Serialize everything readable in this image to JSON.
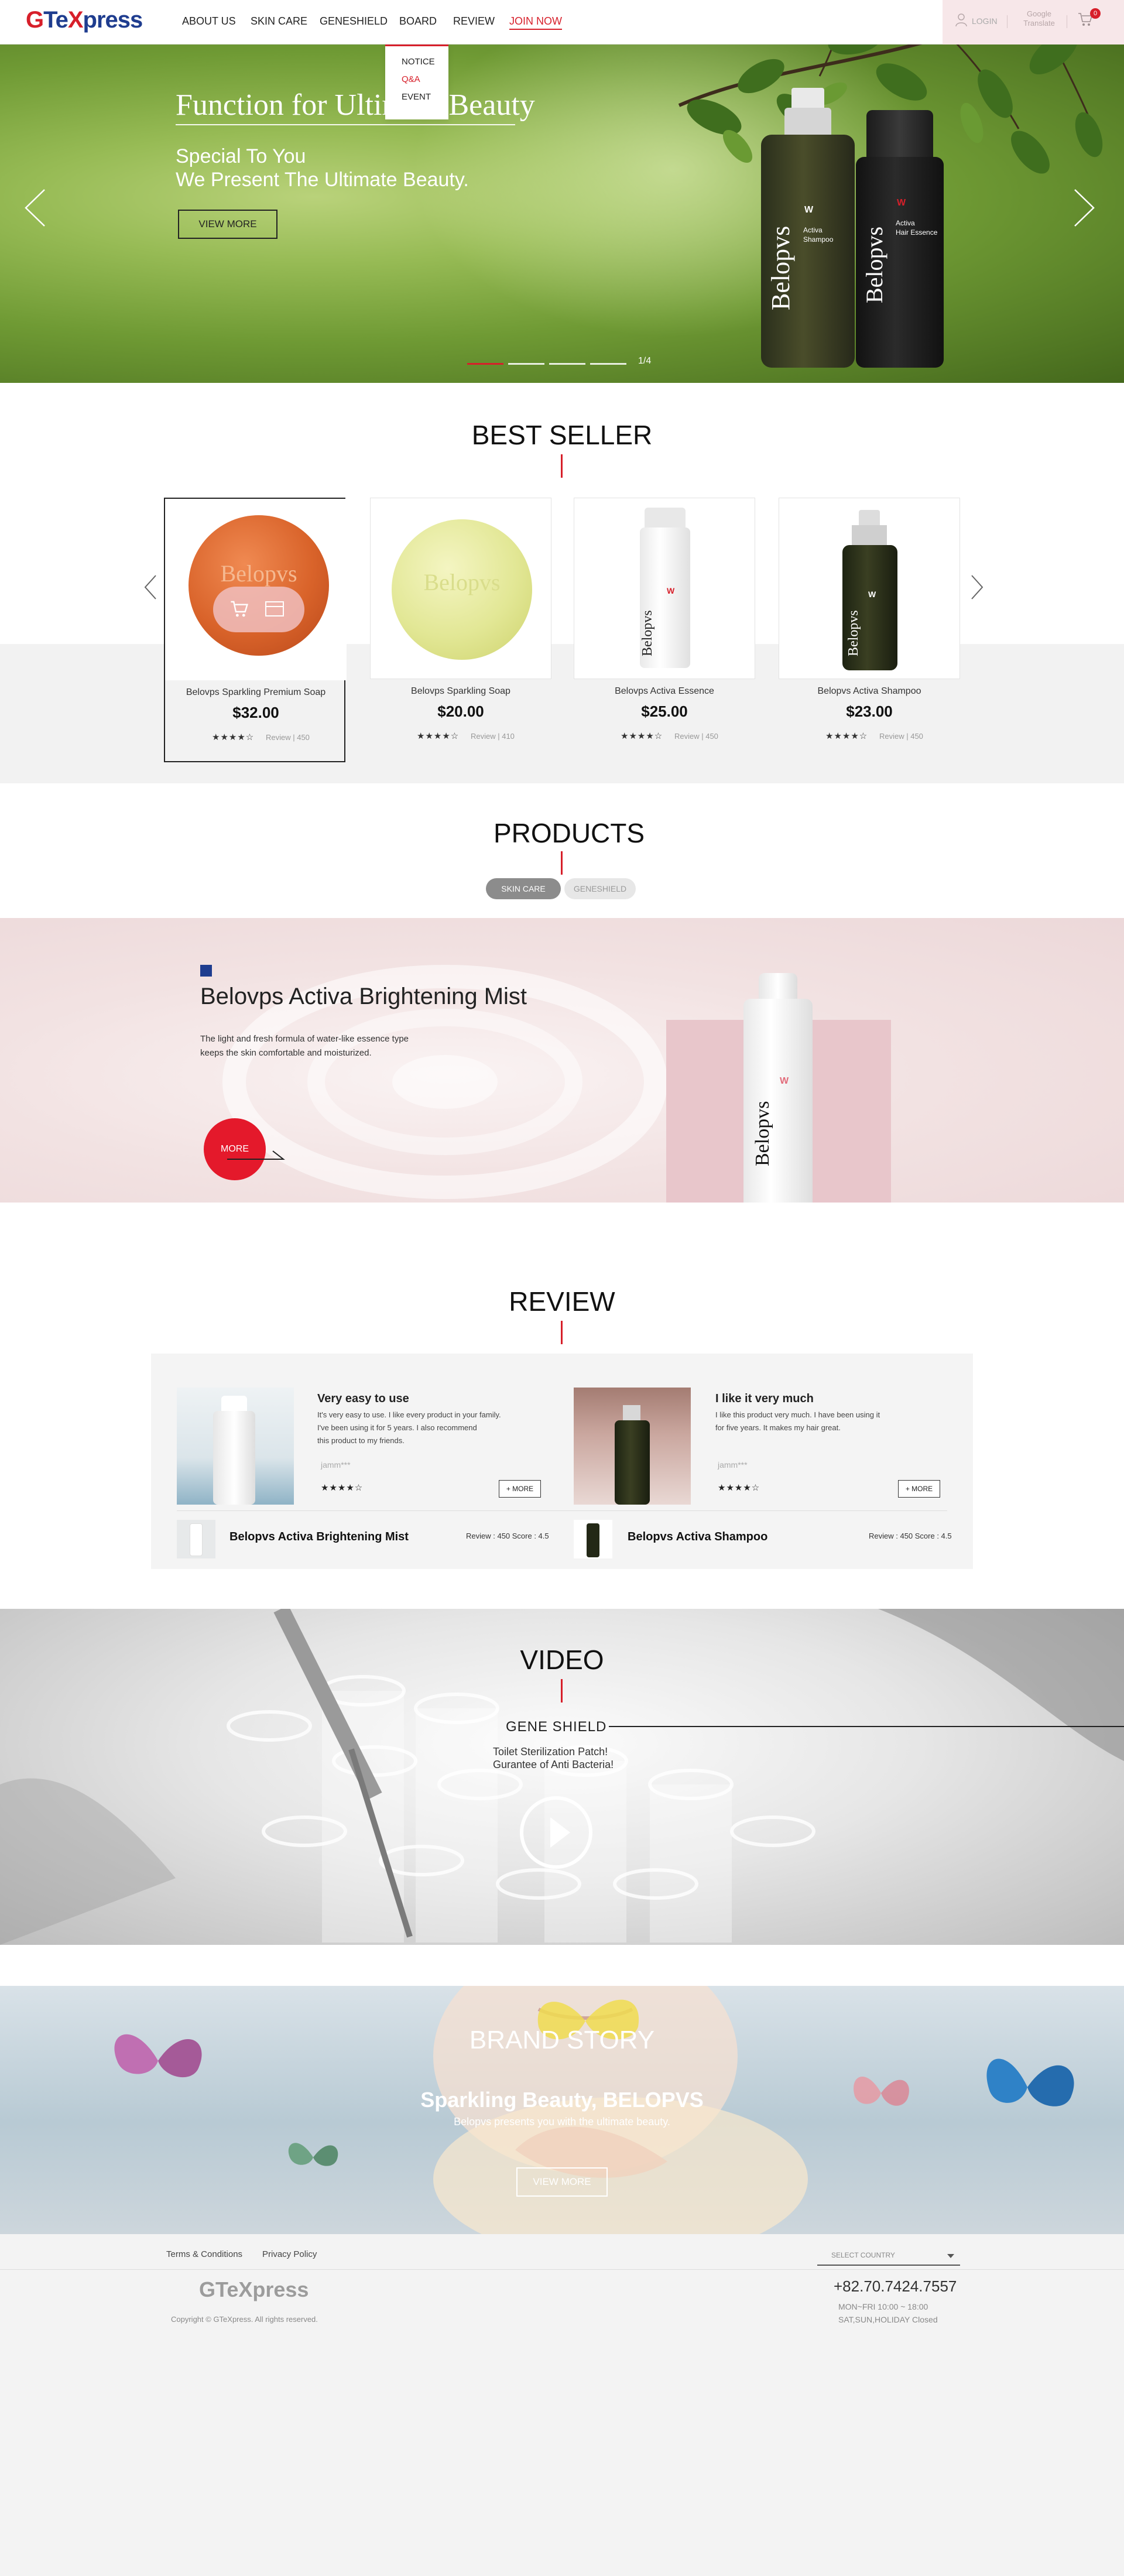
{
  "header": {
    "logo": {
      "part1": "G",
      "part2": "Te",
      "part3": "X",
      "part4": "press"
    },
    "nav": [
      "ABOUT US",
      "SKIN CARE",
      "GENESHIELD",
      "BOARD",
      "REVIEW",
      "JOIN NOW"
    ],
    "board_menu": [
      "NOTICE",
      "Q&A",
      "EVENT"
    ],
    "login": "LOGIN",
    "translate": "Google Translate",
    "cart_count": "0"
  },
  "hero": {
    "title": "Function for Ultimate Beauty",
    "subtitle_line1": "Special To You",
    "subtitle_line2": "We Present The Ultimate Beauty.",
    "button": "VIEW MORE",
    "counter": "1/4",
    "active_slide": 1,
    "bottle1": {
      "brand": "Belopvs",
      "label1": "Activa",
      "label2": "Shampoo"
    },
    "bottle2": {
      "brand": "Belopvs",
      "label1": "Activa",
      "label2": "Hair Essence"
    }
  },
  "best_seller": {
    "title": "BEST SELLER",
    "products": [
      {
        "name": "Belovps Sparkling Premium Soap",
        "price": "$32.00",
        "stars": "★★★★☆",
        "review": "Review  |  450"
      },
      {
        "name": "Belovps Sparkling Soap",
        "price": "$20.00",
        "stars": "★★★★☆",
        "review": "Review  |  410"
      },
      {
        "name": "Belovps Activa Essence",
        "price": "$25.00",
        "stars": "★★★★☆",
        "review": "Review  |  450"
      },
      {
        "name": "Belopvs Activa Shampoo",
        "price": "$23.00",
        "stars": "★★★★☆",
        "review": "Review  |  450"
      }
    ],
    "soap_text": "Belopvs"
  },
  "products": {
    "title": "PRODUCTS",
    "tabs": [
      "SKIN CARE",
      "GENESHIELD"
    ],
    "name": "Belovps Activa Brightening Mist",
    "desc_line1": "The light and fresh formula of water-like essence type",
    "desc_line2": "keeps the skin comfortable and moisturized.",
    "more": "MORE",
    "bottle_brand": "Belopvs"
  },
  "review": {
    "title": "REVIEW",
    "items": [
      {
        "heading": "Very easy to use",
        "text1": "It's very easy to use. I like every product in your family.",
        "text2": "I've been using it for 5 years. I also recommend",
        "text3": "this product to my friends.",
        "user": "jamm***",
        "stars": "★★★★☆",
        "more": "+ MORE",
        "product": "Belopvs Activa Brightening Mist",
        "score": "Review : 450  Score : 4.5"
      },
      {
        "heading": "I like it very much",
        "text1": "I like this product very much. I have been using it",
        "text2": "for five years. It makes my hair great.",
        "text3": "",
        "user": "jamm***",
        "stars": "★★★★☆",
        "more": "+ MORE",
        "product": "Belopvs Activa Shampoo",
        "score": "Review : 450  Score : 4.5"
      }
    ]
  },
  "video": {
    "title": "VIDEO",
    "subtitle": "GENE SHIELD",
    "line1": "Toilet Sterilization Patch!",
    "line2": "Gurantee of Anti Bacteria!"
  },
  "brand_story": {
    "title": "BRAND STORY",
    "subtitle": "Sparkling Beauty, BELOPVS",
    "line": "Belopvs presents you with the ultimate beauty.",
    "button": "VIEW MORE"
  },
  "footer": {
    "terms": "Terms & Conditions",
    "privacy": "Privacy Policy",
    "country": "SELECT COUNTRY",
    "logo": "GTeXpress",
    "copyright": "Copyright © GTeXpress. All rights reserved.",
    "phone": "+82.70.7424.7557",
    "hours1": "MON~FRI  10:00 ~ 18:00",
    "hours2": "SAT,SUN,HOLIDAY  Closed"
  },
  "colors": {
    "accent": "#d71f2a",
    "brand_blue": "#1f3d8f",
    "more_red": "#e4192b"
  }
}
